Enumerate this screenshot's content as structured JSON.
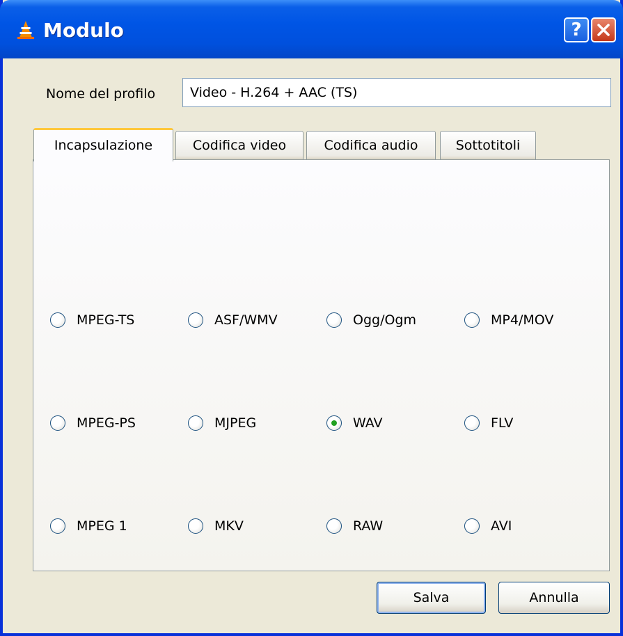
{
  "window": {
    "title": "Modulo",
    "help_label": "?",
    "close_icon": "close-icon",
    "app_icon": "vlc-cone-icon",
    "colors": {
      "titlebar": "#0055e5",
      "close": "#c5381a",
      "tab_highlight": "#ffc83c",
      "radio_dot": "#21a121"
    }
  },
  "profile": {
    "label": "Nome del profilo",
    "value": "Video - H.264 + AAC (TS)"
  },
  "tabs": [
    {
      "label": "Incapsulazione",
      "active": true
    },
    {
      "label": "Codifica video",
      "active": false
    },
    {
      "label": "Codifica audio",
      "active": false
    },
    {
      "label": "Sottotitoli",
      "active": false
    }
  ],
  "encapsulation": {
    "options": [
      {
        "label": "MPEG-TS",
        "selected": false
      },
      {
        "label": "ASF/WMV",
        "selected": false
      },
      {
        "label": "Ogg/Ogm",
        "selected": false
      },
      {
        "label": "MP4/MOV",
        "selected": false
      },
      {
        "label": "MPEG-PS",
        "selected": false
      },
      {
        "label": "MJPEG",
        "selected": false
      },
      {
        "label": "WAV",
        "selected": true
      },
      {
        "label": "FLV",
        "selected": false
      },
      {
        "label": "MPEG 1",
        "selected": false
      },
      {
        "label": "MKV",
        "selected": false
      },
      {
        "label": "RAW",
        "selected": false
      },
      {
        "label": "AVI",
        "selected": false
      }
    ]
  },
  "buttons": {
    "save": "Salva",
    "cancel": "Annulla"
  }
}
